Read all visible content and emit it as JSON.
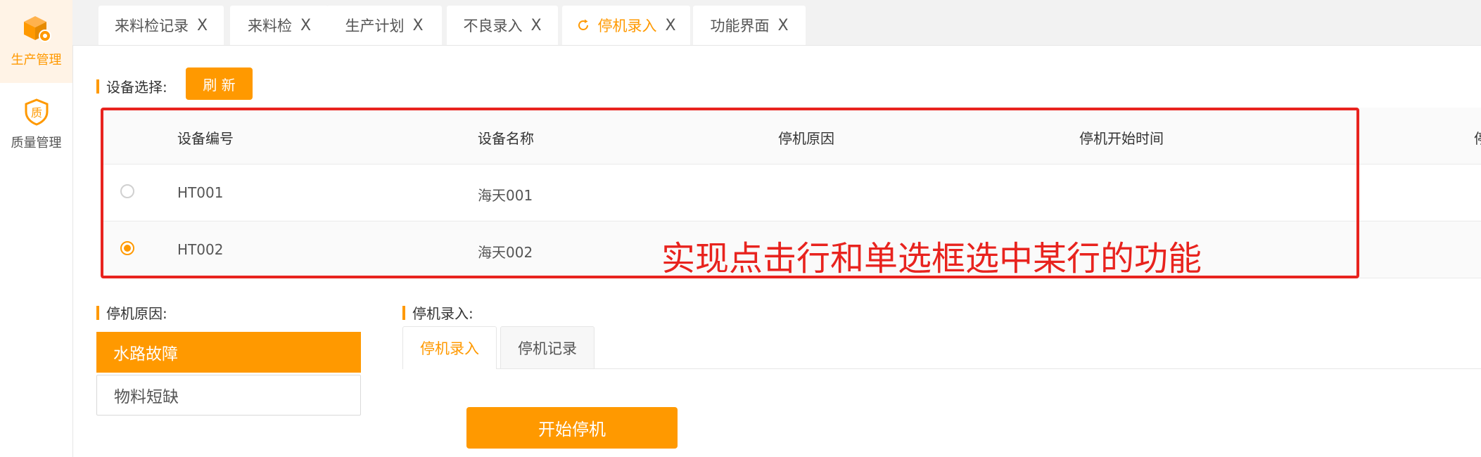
{
  "colors": {
    "accent": "#ff9900",
    "annotation_red": "#e8231e"
  },
  "sidebar": {
    "items": [
      {
        "label": "生产管理",
        "icon": "production-box-icon",
        "active": true
      },
      {
        "label": "质量管理",
        "icon": "quality-shield-icon",
        "active": false
      }
    ]
  },
  "tabs": [
    {
      "label": "来料检记录",
      "close": "X"
    },
    {
      "label": "来料检",
      "close": "X"
    },
    {
      "label": "生产计划",
      "close": "X"
    },
    {
      "label": "不良录入",
      "close": "X"
    },
    {
      "label": "停机录入",
      "close": "X",
      "active": true
    },
    {
      "label": "功能界面",
      "close": "X"
    }
  ],
  "device_select": {
    "label": "设备选择:",
    "refresh_label": "刷 新"
  },
  "table": {
    "columns": [
      "设备编号",
      "设备名称",
      "停机原因",
      "停机开始时间",
      "停"
    ],
    "rows": [
      {
        "code": "HT001",
        "name": "海天001",
        "reason": "",
        "start": "",
        "selected": false
      },
      {
        "code": "HT002",
        "name": "海天002",
        "reason": "",
        "start": "",
        "selected": true
      }
    ]
  },
  "annotation": "实现点击行和单选框选中某行的功能",
  "reasons": {
    "label": "停机原因:",
    "items": [
      {
        "label": "水路故障",
        "active": true
      },
      {
        "label": "物料短缺",
        "active": false
      }
    ]
  },
  "entry": {
    "label": "停机录入:",
    "subtabs": [
      {
        "label": "停机录入",
        "active": true
      },
      {
        "label": "停机记录",
        "active": false
      }
    ],
    "start_button": "开始停机"
  }
}
